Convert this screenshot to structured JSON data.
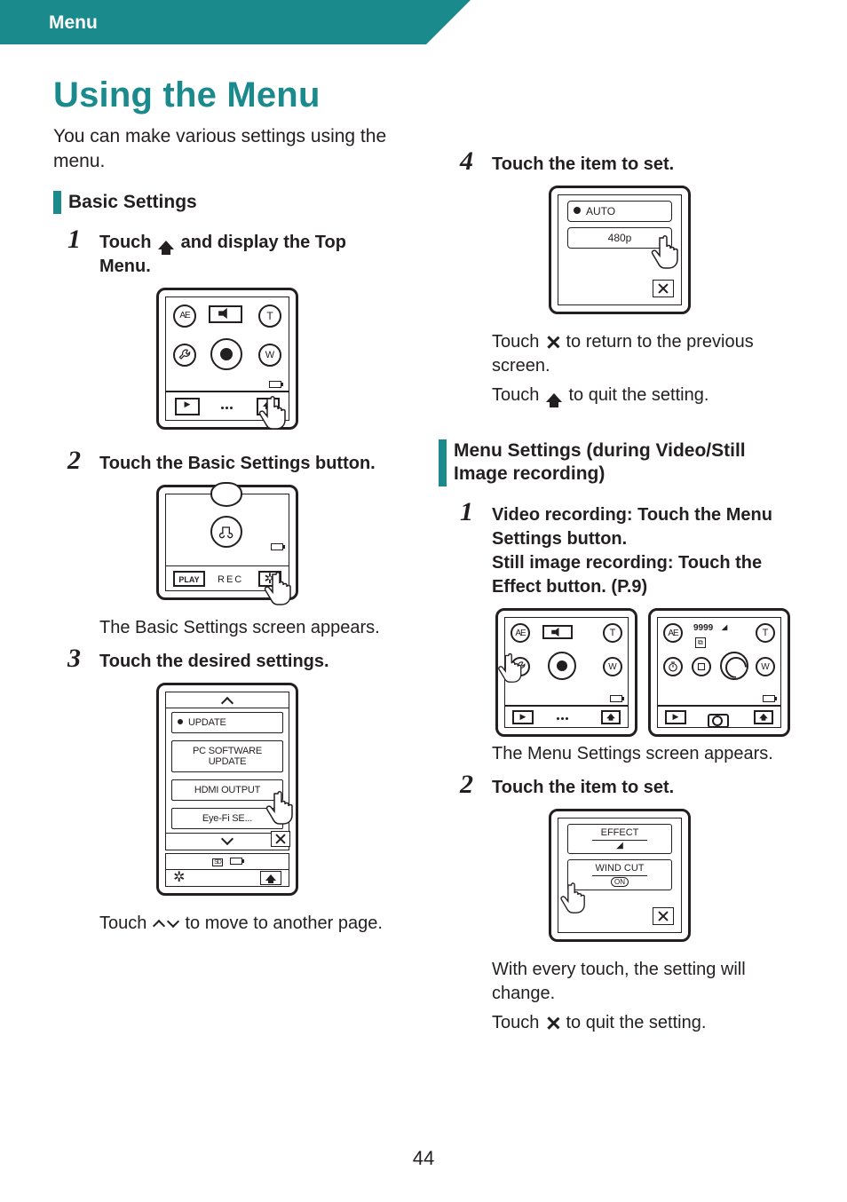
{
  "header": {
    "title": "Menu"
  },
  "page_number": "44",
  "title": "Using the Menu",
  "intro": "You can make various settings using the menu.",
  "sections": {
    "basic": {
      "heading": "Basic Settings",
      "step1": {
        "num": "1",
        "prefix": "Touch ",
        "suffix": " and display the Top Menu."
      },
      "step2": {
        "num": "2",
        "body": "Touch the Basic Settings button.",
        "note": "The Basic Settings screen appears."
      },
      "step3": {
        "num": "3",
        "body": "Touch the desired settings.",
        "note": "to move to another page.",
        "note_prefix": "Touch "
      },
      "step4": {
        "num": "4",
        "body": "Touch the item to set.",
        "note1a": "Touch ",
        "note1b": " to return to the previous screen.",
        "note2a": "Touch ",
        "note2b": " to quit the setting."
      }
    },
    "menu_settings": {
      "heading": "Menu Settings (during Video/Still Image recording)",
      "step1": {
        "num": "1",
        "body": "Video recording: Touch the Menu Settings button.\nStill image recording: Touch the Effect button. (P.9)",
        "note": "The Menu Settings screen appears."
      },
      "step2": {
        "num": "2",
        "body": "Touch the item to set.",
        "note1": "With every touch, the setting will change.",
        "note2a": "Touch ",
        "note2b": " to quit the setting."
      }
    }
  },
  "figures": {
    "top_menu": {
      "ae_label": "AE",
      "t_label": "T",
      "w_label": "W"
    },
    "basic_settings_button": {
      "play_label": "PLAY",
      "rec_label": "REC"
    },
    "settings_list": {
      "items": [
        "UPDATE",
        "PC SOFTWARE UPDATE",
        "HDMI OUTPUT",
        "Eye-Fi SE..."
      ]
    },
    "item_set": {
      "items": [
        "AUTO",
        "480p"
      ]
    },
    "dual_left": {
      "ae_label": "AE",
      "t_label": "T",
      "w_label": "W"
    },
    "dual_right": {
      "ae_label": "AE",
      "t_label": "T",
      "w_label": "W",
      "count": "9999"
    },
    "fx_list": {
      "items": [
        "EFFECT",
        "WIND CUT"
      ],
      "on_label": "ON"
    }
  }
}
